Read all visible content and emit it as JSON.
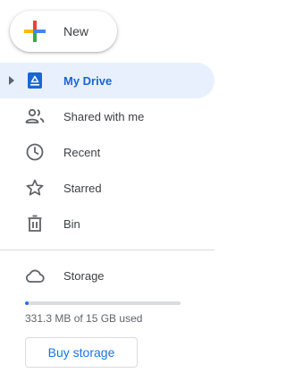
{
  "new_button": {
    "label": "New",
    "icon": "plus-icon"
  },
  "nav": {
    "items": [
      {
        "label": "My Drive",
        "icon": "my-drive-icon",
        "active": true
      },
      {
        "label": "Shared with me",
        "icon": "shared-people-icon"
      },
      {
        "label": "Recent",
        "icon": "clock-icon"
      },
      {
        "label": "Starred",
        "icon": "star-icon"
      },
      {
        "label": "Bin",
        "icon": "trash-icon"
      }
    ]
  },
  "storage": {
    "label": "Storage",
    "icon": "cloud-icon",
    "usage_text": "331.3 MB of 15 GB used",
    "used_fraction": 0.022,
    "buy_label": "Buy storage"
  },
  "colors": {
    "accent": "#1a73e8",
    "active_bg": "#e8f0fe",
    "active_text": "#1967d2",
    "icon": "#5f6368",
    "divider": "#dadce0"
  }
}
